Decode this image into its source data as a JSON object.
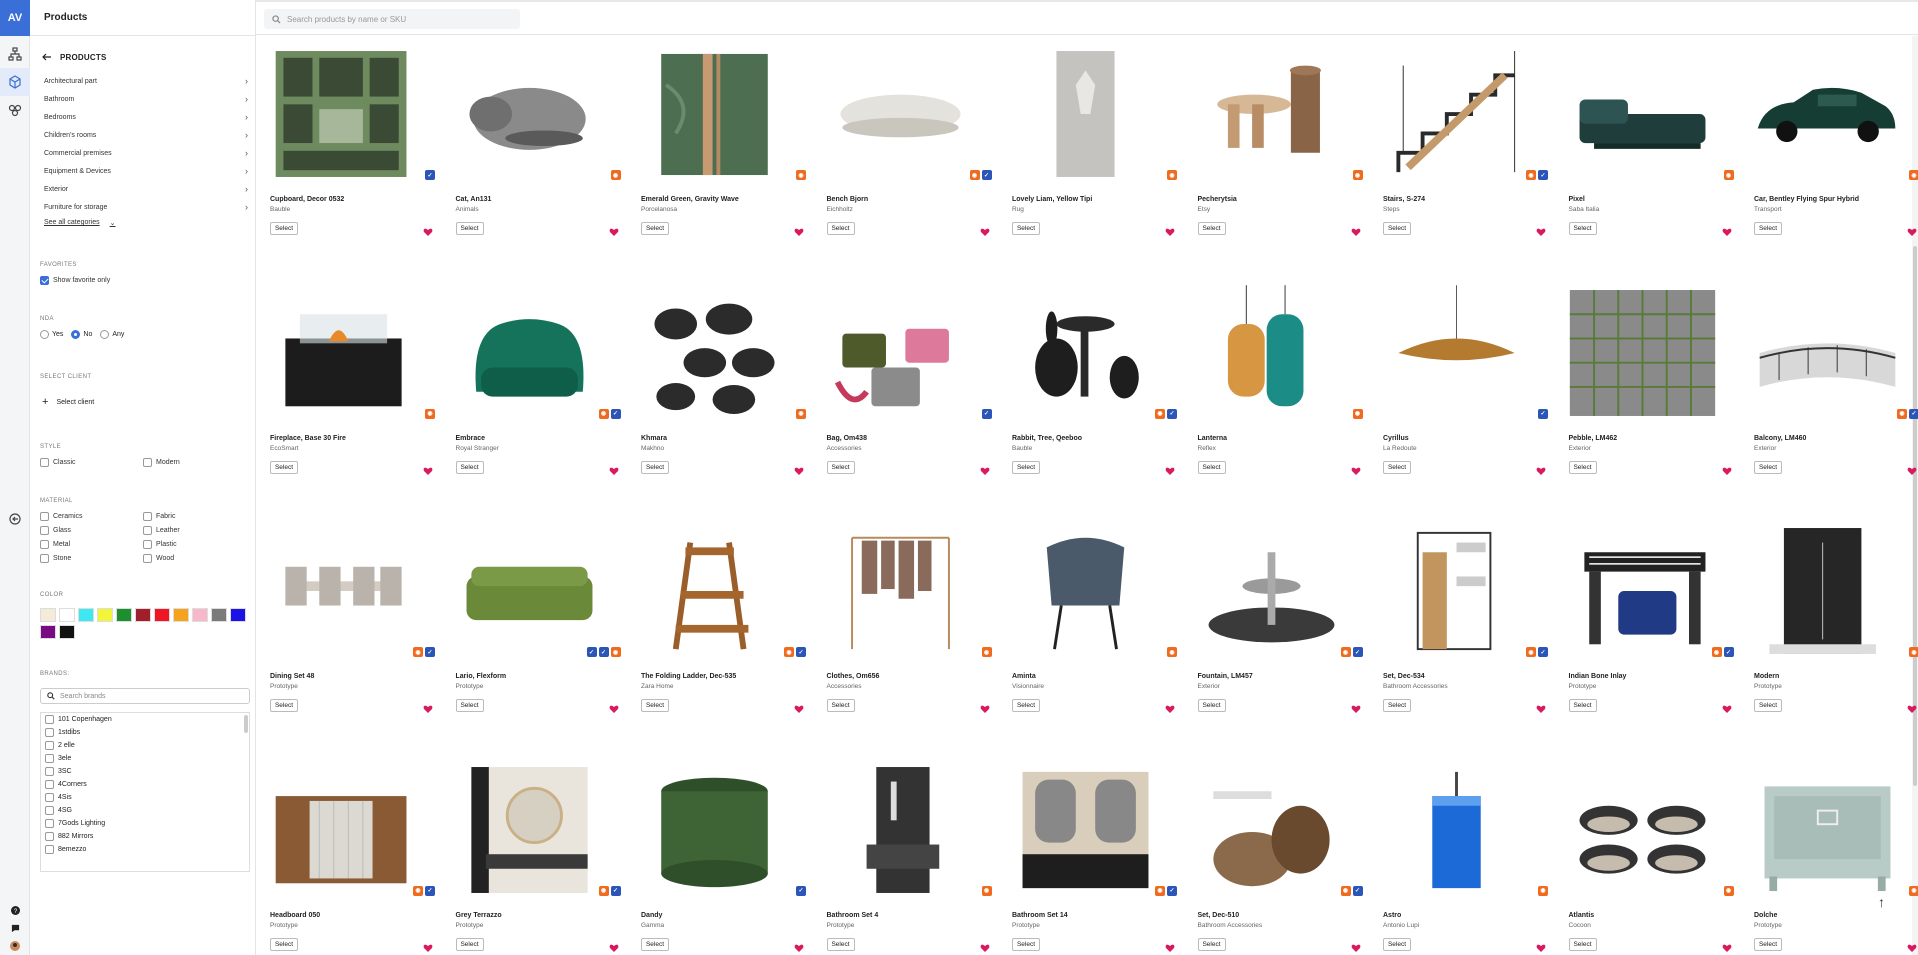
{
  "app": {
    "logo": "AV",
    "panel_title": "Products"
  },
  "nav_back_label": "PRODUCTS",
  "categories": [
    "Architectural part",
    "Bathroom",
    "Bedrooms",
    "Children's rooms",
    "Commercial premises",
    "Equipment & Devices",
    "Exterior",
    "Furniture for storage"
  ],
  "see_all": "See all categories",
  "favorites": {
    "title": "FAVORITES",
    "show_label": "Show favorite only",
    "checked": true
  },
  "nda": {
    "title": "NDA",
    "options": [
      "Yes",
      "No",
      "Any"
    ],
    "selected": "No"
  },
  "client": {
    "title": "SELECT CLIENT",
    "button": "Select client"
  },
  "style": {
    "title": "STYLE",
    "options": [
      "Classic",
      "Modern"
    ]
  },
  "material": {
    "title": "MATERIAL",
    "left": [
      "Ceramics",
      "Glass",
      "Metal",
      "Stone"
    ],
    "right": [
      "Fabric",
      "Leather",
      "Plastic",
      "Wood"
    ]
  },
  "color": {
    "title": "COLOR",
    "swatches": [
      "#f5ecd7",
      "#ffffff",
      "#3ee8f0",
      "#f3f53a",
      "#1e8f2e",
      "#a11f2b",
      "#f01525",
      "#f5a21e",
      "#f7b8c9",
      "#7a7a7a",
      "#1b12e8",
      "#7a0a84",
      "#111111"
    ]
  },
  "brands": {
    "title": "BRANDS:",
    "search_placeholder": "Search brands",
    "list": [
      "101 Copenhagen",
      "1stdibs",
      "2 elle",
      "3ele",
      "3SC",
      "4Corners",
      "4Sis",
      "4SG",
      "7Gods Lighting",
      "882 Mirrors",
      "8emezzo"
    ]
  },
  "search": {
    "placeholder": "Search products by name or SKU"
  },
  "select_label": "Select",
  "products": [
    {
      "name": "Cupboard, Decor 0532",
      "brand": "Bauble",
      "badges": [
        "b"
      ],
      "icon": "cupboard"
    },
    {
      "name": "Cat, An131",
      "brand": "Animals",
      "badges": [
        "o"
      ],
      "icon": "cat"
    },
    {
      "name": "Emerald Green, Gravity Wave",
      "brand": "Porcelanosa",
      "badges": [
        "o"
      ],
      "icon": "tile"
    },
    {
      "name": "Bench Bjorn",
      "brand": "Eichholtz",
      "badges": [
        "o",
        "b"
      ],
      "icon": "bench"
    },
    {
      "name": "Lovely Liam, Yellow Tipi",
      "brand": "Rug",
      "badges": [
        "o"
      ],
      "icon": "rug"
    },
    {
      "name": "Pecherytsia",
      "brand": "Etsy",
      "badges": [
        "o"
      ],
      "icon": "table"
    },
    {
      "name": "Stairs, S-274",
      "brand": "Steps",
      "badges": [
        "o",
        "b"
      ],
      "icon": "stairs"
    },
    {
      "name": "Pixel",
      "brand": "Saba Italia",
      "badges": [
        "o"
      ],
      "icon": "bed"
    },
    {
      "name": "Car, Bentley Flying Spur Hybrid",
      "brand": "Transport",
      "badges": [
        "o"
      ],
      "icon": "car"
    },
    {
      "name": "Fireplace, Base 30 Fire",
      "brand": "EcoSmart",
      "badges": [
        "o"
      ],
      "icon": "fireplace"
    },
    {
      "name": "Embrace",
      "brand": "Royal Stranger",
      "badges": [
        "o",
        "b"
      ],
      "icon": "armchair"
    },
    {
      "name": "Khmara",
      "brand": "Makhno",
      "badges": [
        "o"
      ],
      "icon": "pendants"
    },
    {
      "name": "Bag, Om438",
      "brand": "Accessories",
      "badges": [
        "b"
      ],
      "icon": "bags"
    },
    {
      "name": "Rabbit, Tree, Qeeboo",
      "brand": "Bauble",
      "badges": [
        "o",
        "b"
      ],
      "icon": "rabbit"
    },
    {
      "name": "Lanterna",
      "brand": "Reflex",
      "badges": [
        "o"
      ],
      "icon": "lanterns"
    },
    {
      "name": "Cyrillus",
      "brand": "La Redoute",
      "badges": [
        "b"
      ],
      "icon": "lamp"
    },
    {
      "name": "Pebble, LM462",
      "brand": "Exterior",
      "badges": [],
      "icon": "pavers"
    },
    {
      "name": "Balcony, LM460",
      "brand": "Exterior",
      "badges": [
        "o",
        "b"
      ],
      "icon": "balcony"
    },
    {
      "name": "Dining Set 48",
      "brand": "Prototype",
      "badges": [
        "o",
        "b"
      ],
      "icon": "dining"
    },
    {
      "name": "Lario, Flexform",
      "brand": "Prototype",
      "badges": [
        "b",
        "b",
        "o"
      ],
      "icon": "sofa"
    },
    {
      "name": "The Folding Ladder, Dec-535",
      "brand": "Zara Home",
      "badges": [
        "o",
        "b"
      ],
      "icon": "ladder"
    },
    {
      "name": "Clothes, Om656",
      "brand": "Accessories",
      "badges": [
        "o"
      ],
      "icon": "rack"
    },
    {
      "name": "Aminta",
      "brand": "Visionnaire",
      "badges": [
        "o"
      ],
      "icon": "chair"
    },
    {
      "name": "Fountain, LM457",
      "brand": "Exterior",
      "badges": [
        "o",
        "b"
      ],
      "icon": "fountain"
    },
    {
      "name": "Set, Dec-534",
      "brand": "Bathroom Accessories",
      "badges": [
        "o",
        "b"
      ],
      "icon": "shelf"
    },
    {
      "name": "Indian Bone Inlay",
      "brand": "Prototype",
      "badges": [
        "o",
        "b"
      ],
      "icon": "console"
    },
    {
      "name": "Modern",
      "brand": "Prototype",
      "badges": [
        "o"
      ],
      "icon": "shower"
    },
    {
      "name": "Headboard 050",
      "brand": "Prototype",
      "badges": [
        "o",
        "b"
      ],
      "icon": "headboard"
    },
    {
      "name": "Grey Terrazzo",
      "brand": "Prototype",
      "badges": [
        "o",
        "b"
      ],
      "icon": "mirror"
    },
    {
      "name": "Dandy",
      "brand": "Gamma",
      "badges": [
        "b"
      ],
      "icon": "pouf"
    },
    {
      "name": "Bathroom Set 4",
      "brand": "Prototype",
      "badges": [
        "o"
      ],
      "icon": "vanity"
    },
    {
      "name": "Bathroom Set 14",
      "brand": "Prototype",
      "badges": [
        "o",
        "b"
      ],
      "icon": "vanity2"
    },
    {
      "name": "Set, Dec-510",
      "brand": "Bathroom Accessories",
      "badges": [
        "o",
        "b"
      ],
      "icon": "baskets"
    },
    {
      "name": "Astro",
      "brand": "Antonio Lupi",
      "badges": [
        "o"
      ],
      "icon": "basin"
    },
    {
      "name": "Atlantis",
      "brand": "Cocoon",
      "badges": [
        "o"
      ],
      "icon": "sinks"
    },
    {
      "name": "Dolche",
      "brand": "Prototype",
      "badges": [
        "o"
      ],
      "icon": "cabinet"
    }
  ]
}
